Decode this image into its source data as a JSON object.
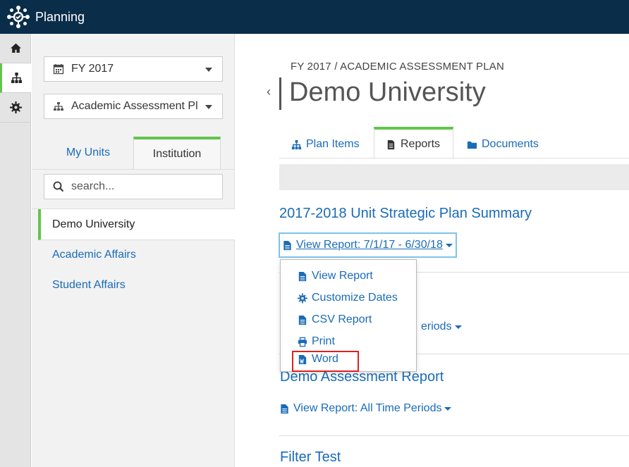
{
  "app": {
    "title": "Planning"
  },
  "rail": {
    "items": [
      "home-icon",
      "sitemap-icon",
      "gear-icon"
    ],
    "active_index": 1
  },
  "sidebar": {
    "fiscal_year": "FY 2017",
    "plan": "Academic Assessment Pl",
    "tabs": [
      {
        "label": "My Units"
      },
      {
        "label": "Institution",
        "active": true
      }
    ],
    "search_placeholder": "search...",
    "units": [
      {
        "label": "Demo University",
        "active": true
      },
      {
        "label": "Academic Affairs"
      },
      {
        "label": "Student Affairs"
      }
    ]
  },
  "main": {
    "breadcrumb": "FY 2017 / ACADEMIC ASSESSMENT PLAN",
    "title": "Demo University",
    "tabs": [
      {
        "label": "Plan Items"
      },
      {
        "label": "Reports",
        "active": true
      },
      {
        "label": "Documents"
      }
    ],
    "reports": [
      {
        "title": "2017-2018 Unit Strategic Plan Summary",
        "view_label": "View Report: 7/1/17 - 6/30/18"
      },
      {
        "title": "",
        "view_label_fragment": "eriods"
      },
      {
        "title": "Demo Assessment Report",
        "view_label": "View Report: All Time Periods"
      },
      {
        "title": "Filter Test"
      }
    ],
    "dropdown": {
      "items": [
        {
          "label": "View Report",
          "icon": "file-icon"
        },
        {
          "label": "Customize Dates",
          "icon": "gear-icon"
        },
        {
          "label": "CSV Report",
          "icon": "file-icon"
        },
        {
          "label": "Print",
          "icon": "print-icon"
        },
        {
          "label": "Word",
          "icon": "word-file-icon",
          "highlighted": true
        }
      ]
    }
  },
  "colors": {
    "topbar": "#0a2d4a",
    "accent": "#62c44b",
    "link": "#1a6bb8",
    "highlight": "#e02020"
  }
}
